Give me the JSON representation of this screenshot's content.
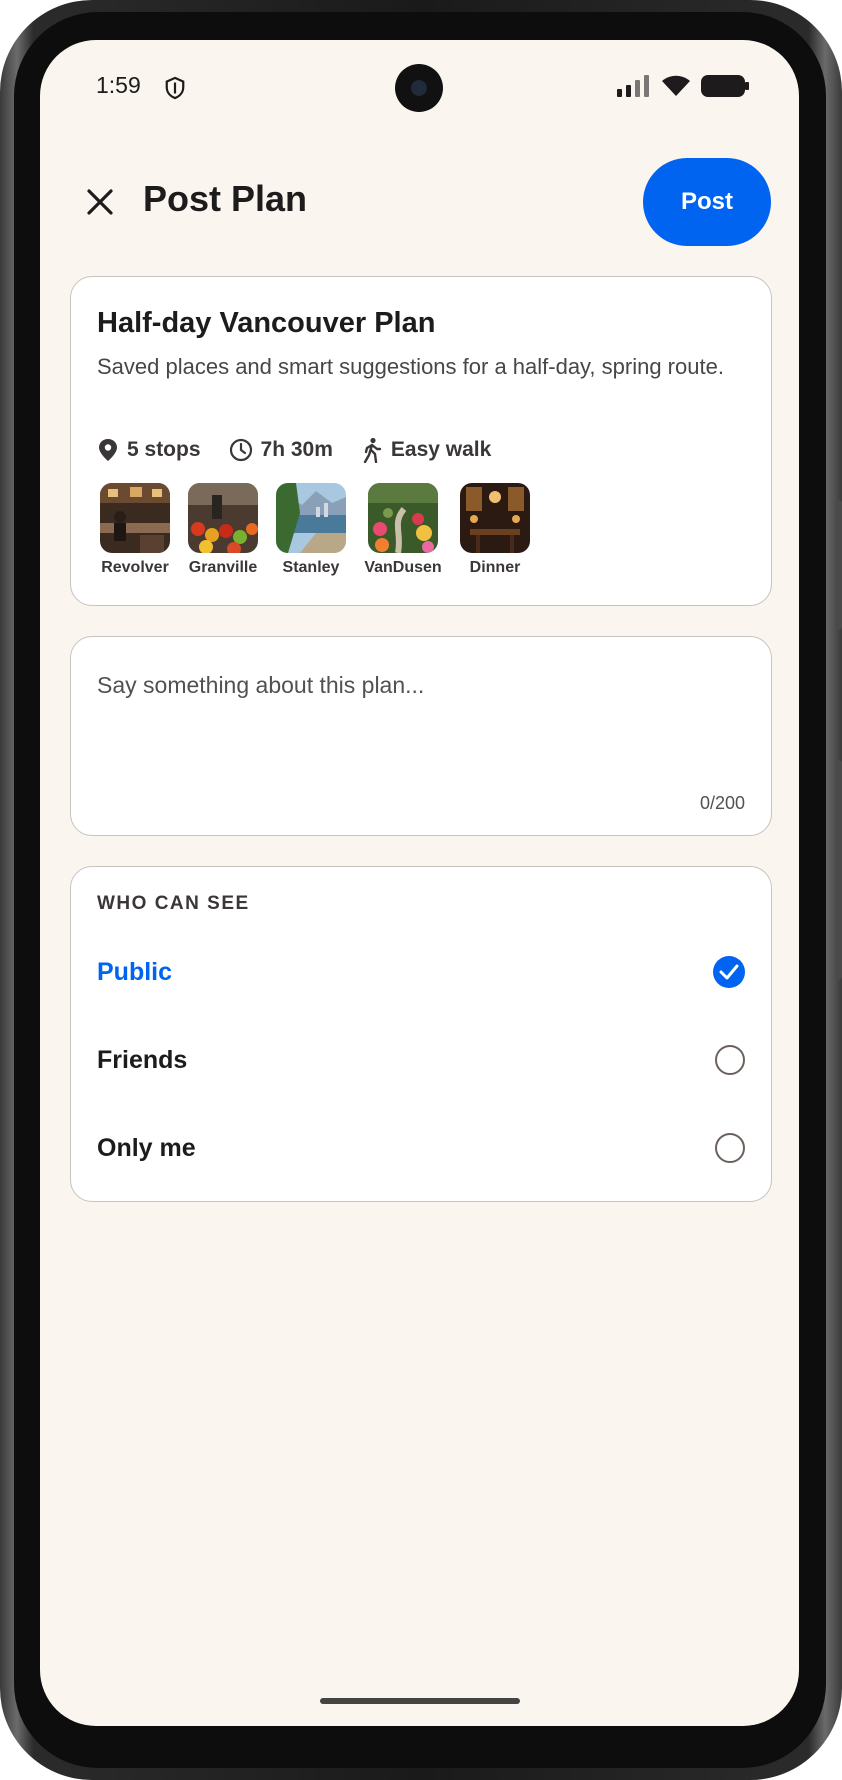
{
  "status_bar": {
    "time": "1:59"
  },
  "header": {
    "title": "Post Plan",
    "post_label": "Post"
  },
  "plan": {
    "title": "Half-day Vancouver Plan",
    "description": "Saved places and smart suggestions for a half-day, spring route.",
    "stops": "5 stops",
    "duration": "7h 30m",
    "walk": "Easy walk",
    "places": [
      {
        "label": "Revolver",
        "image": "cafe-photo"
      },
      {
        "label": "Granville",
        "image": "market-photo"
      },
      {
        "label": "Stanley",
        "image": "seawall-photo"
      },
      {
        "label": "VanDusen",
        "image": "garden-photo"
      },
      {
        "label": "Dinner",
        "image": "restaurant-photo"
      }
    ]
  },
  "comment": {
    "placeholder": "Say something about this plan...",
    "value": "",
    "count": "0/200"
  },
  "visibility": {
    "heading": "WHO CAN SEE",
    "selected": "Public",
    "options": [
      {
        "label": "Public"
      },
      {
        "label": "Friends"
      },
      {
        "label": "Only me"
      }
    ]
  },
  "colors": {
    "accent": "#0064f0",
    "background": "#faf6ef",
    "card": "#ffffff"
  }
}
